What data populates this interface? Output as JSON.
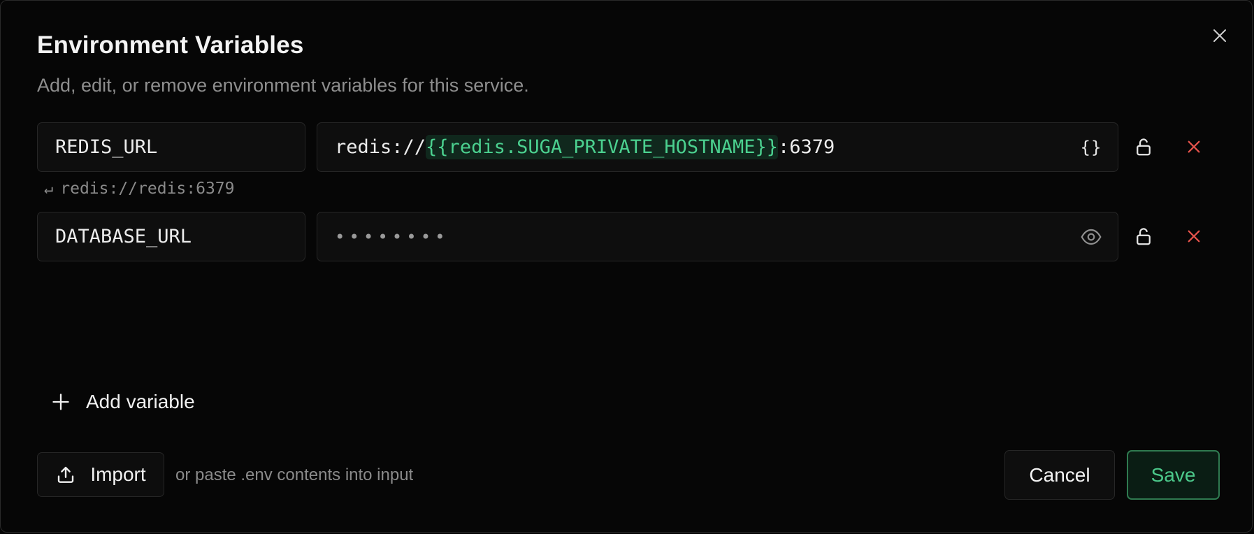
{
  "dialog": {
    "title": "Environment Variables",
    "subtitle": "Add, edit, or remove environment variables for this service.",
    "close_icon": "close-icon"
  },
  "variables": [
    {
      "key": "REDIS_URL",
      "value_prefix": "redis://",
      "value_reference": "{{redis.SUGA_PRIVATE_HOSTNAME}}",
      "value_suffix": ":6379",
      "value_action_icon": "braces-icon",
      "value_action_label": "{}",
      "resolved_arrow": "↵",
      "resolved_value": "redis://redis:6379",
      "lock_icon": "unlock-icon",
      "remove_icon": "remove-icon"
    },
    {
      "key": "DATABASE_URL",
      "masked_value": "••••••••",
      "value_action_icon": "eye-icon",
      "lock_icon": "unlock-icon",
      "remove_icon": "remove-icon"
    }
  ],
  "actions": {
    "add_variable": "Add variable",
    "import": "Import",
    "import_hint": "or paste .env contents into input",
    "cancel": "Cancel",
    "save": "Save"
  },
  "colors": {
    "background": "#060606",
    "reference_text": "#4bd08f",
    "reference_bg": "#10281d",
    "remove": "#e5534b",
    "save_border": "#2f7a50",
    "save_text": "#4cc98b"
  }
}
